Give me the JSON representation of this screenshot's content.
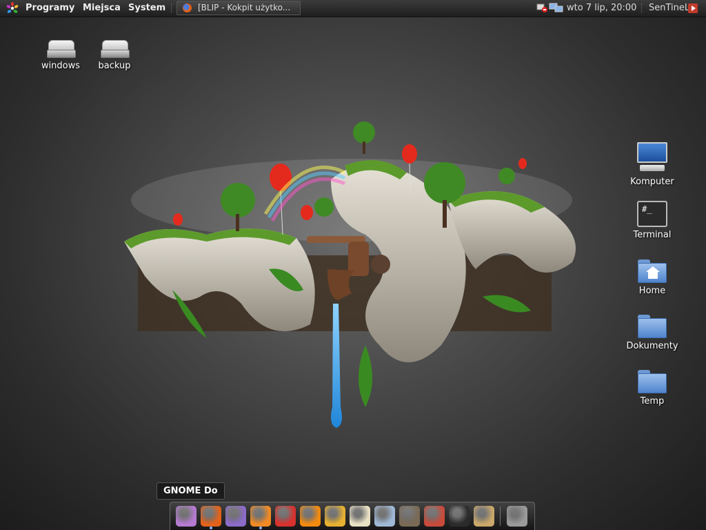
{
  "panel": {
    "menus": [
      "Programy",
      "Miejsca",
      "System"
    ],
    "task_window": "[BLIP - Kokpit użytko...",
    "clock": "wto  7 lip, 20:00",
    "user": "SenTineL"
  },
  "desktop_left": [
    {
      "label": "windows",
      "icon": "drive-icon"
    },
    {
      "label": "backup",
      "icon": "drive-icon"
    }
  ],
  "desktop_right": [
    {
      "label": "Komputer",
      "icon": "computer-icon"
    },
    {
      "label": "Terminal",
      "icon": "terminal-icon",
      "glyph": "#_"
    },
    {
      "label": "Home",
      "icon": "home-folder-icon"
    },
    {
      "label": "Dokumenty",
      "icon": "folder-icon"
    },
    {
      "label": "Temp",
      "icon": "folder-icon"
    }
  ],
  "tooltip": "GNOME Do",
  "dock": {
    "items": [
      {
        "name": "gnome-do-icon",
        "color": "#b57ad1"
      },
      {
        "name": "firefox-icon",
        "color": "#e3621b"
      },
      {
        "name": "pidgin-icon",
        "color": "#8c6bc9"
      },
      {
        "name": "twitter-bird-icon",
        "color": "#f08a24"
      },
      {
        "name": "miro-icon",
        "color": "#d8312e"
      },
      {
        "name": "vlc-icon",
        "color": "#f28a10"
      },
      {
        "name": "system-monitor-icon",
        "color": "#e6b031"
      },
      {
        "name": "text-editor-icon",
        "color": "#e8e0c4"
      },
      {
        "name": "world-clock-icon",
        "color": "#9fb8d6"
      },
      {
        "name": "gimp-icon",
        "color": "#7a6a55"
      },
      {
        "name": "software-install-icon",
        "color": "#c94a3a"
      },
      {
        "name": "terminal-icon",
        "color": "#2b2b2b"
      },
      {
        "name": "archive-manager-icon",
        "color": "#c9a86a"
      },
      {
        "name": "trash-icon",
        "color": "#9a9a9a"
      }
    ]
  }
}
